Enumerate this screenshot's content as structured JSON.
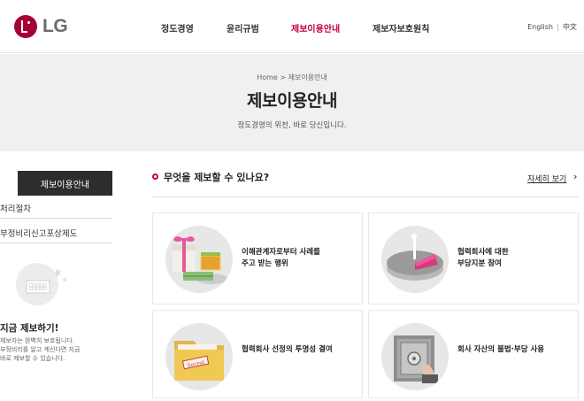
{
  "header": {
    "logo_text": "LG",
    "nav": [
      {
        "label": "정도경영",
        "active": false
      },
      {
        "label": "윤리규범",
        "active": false
      },
      {
        "label": "제보이용안내",
        "active": true
      },
      {
        "label": "제보자보호원칙",
        "active": false
      }
    ],
    "lang_en": "English",
    "lang_cn": "中文"
  },
  "hero": {
    "breadcrumb": "Home > 제보이용안내",
    "title": "제보이용안내",
    "subtitle": "정도경영의 위천, 바로 당신입니다."
  },
  "sidebar": {
    "active_label": "제보이용안내",
    "items": [
      "처리절차",
      "부정비리신고포상제도"
    ],
    "report_title": "지금 제보하기!",
    "report_desc": "제보자는 완벽히 보호됩니다.\n부정비리를 알고 계신다면 지금\n바로 제보할 수 있습니다."
  },
  "main": {
    "question": "무엇을 제보할 수 있나요?",
    "more_link": "자세히 보기",
    "cards": [
      {
        "label": "이해관계자로부터 사례를\n주고 받는 행위",
        "icon": "gift-money-icon"
      },
      {
        "label": "협력회사에 대한\n부당지분 참여",
        "icon": "pie-chart-icon"
      },
      {
        "label": "협력회사 선정의 투명성 결여",
        "icon": "secret-folder-icon"
      },
      {
        "label": "회사 자산의 불법·부당 사용",
        "icon": "safe-icon"
      }
    ]
  },
  "colors": {
    "brand": "#a50034",
    "accent": "#c4003e",
    "hero_bg": "#f0f0f0",
    "sidebar_active_bg": "#2d2d2d"
  }
}
